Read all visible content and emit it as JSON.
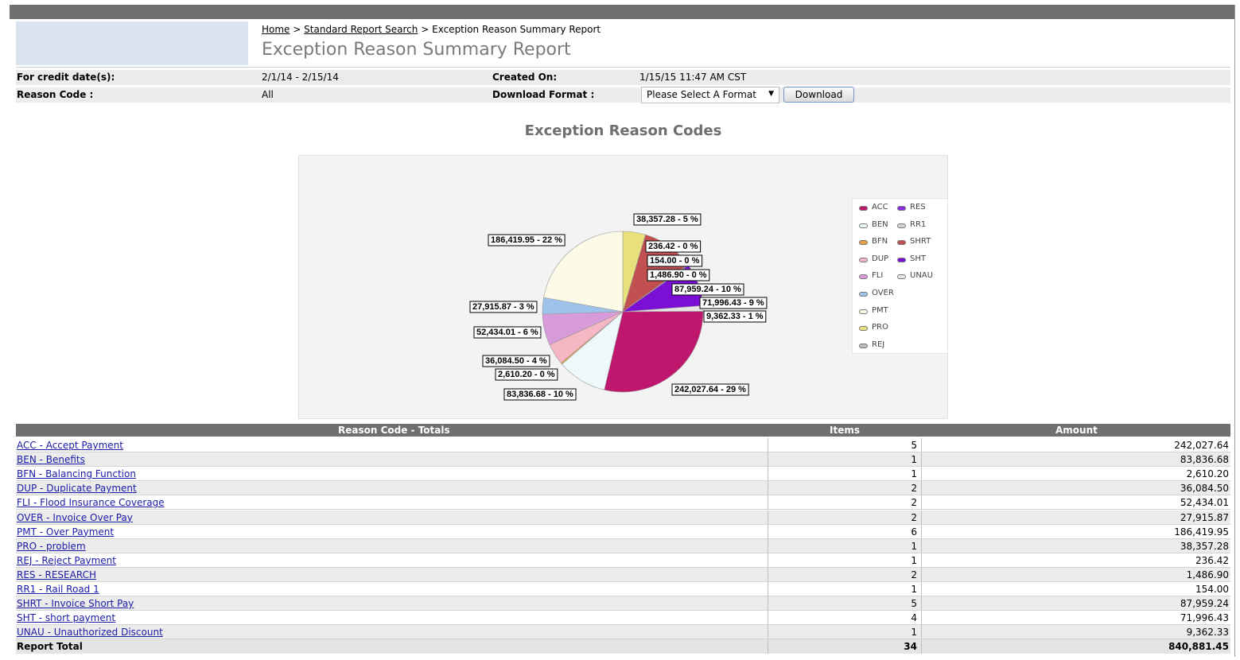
{
  "breadcrumb": {
    "home": "Home",
    "sep1": ">",
    "search": "Standard Report Search",
    "sep2": ">",
    "current": "Exception Reason Summary Report"
  },
  "page_title": "Exception Reason Summary Report",
  "info": {
    "credit_label": "For credit date(s):",
    "credit_value": "2/1/14 - 2/15/14",
    "created_label": "Created On:",
    "created_value": "1/15/15 11:47 AM CST",
    "reason_label": "Reason Code :",
    "reason_value": "All",
    "format_label": "Download Format :",
    "format_value": "Please Select A Format",
    "download_label": "Download"
  },
  "colors": {
    "ACC": "#c0176e",
    "BEN": "#eef8fb",
    "BFN": "#e8a040",
    "DUP": "#f6b7c4",
    "FLI": "#d79bd9",
    "OVER": "#9ec3ea",
    "PMT": "#fcfbe8",
    "PRO": "#e8e07a",
    "REJ": "#bdbdbd",
    "RES": "#8a2be2",
    "RR1": "#d4d4d4",
    "SHRT": "#c25050",
    "SHT": "#7b0fd6",
    "UNAU": "#e6e6e6"
  },
  "chart_data": {
    "type": "pie",
    "title": "Exception Reason Codes",
    "legend_position": "right",
    "slices": [
      {
        "code": "ACC",
        "value": 242027.64,
        "label": "242,027.64 - 29 %"
      },
      {
        "code": "BEN",
        "value": 83836.68,
        "label": "83,836.68 - 10 %"
      },
      {
        "code": "BFN",
        "value": 2610.2,
        "label": "2,610.20 - 0 %"
      },
      {
        "code": "DUP",
        "value": 36084.5,
        "label": "36,084.50 - 4 %"
      },
      {
        "code": "FLI",
        "value": 52434.01,
        "label": "52,434.01 - 6 %"
      },
      {
        "code": "OVER",
        "value": 27915.87,
        "label": "27,915.87 - 3 %"
      },
      {
        "code": "PMT",
        "value": 186419.95,
        "label": "186,419.95 - 22 %"
      },
      {
        "code": "PRO",
        "value": 38357.28,
        "label": "38,357.28 - 5 %"
      },
      {
        "code": "REJ",
        "value": 236.42,
        "label": "236.42 - 0 %"
      },
      {
        "code": "RES",
        "value": 1486.9,
        "label": "1,486.90 - 0 %"
      },
      {
        "code": "RR1",
        "value": 154.0,
        "label": "154.00 - 0 %"
      },
      {
        "code": "SHRT",
        "value": 87959.24,
        "label": "87,959.24 - 10 %"
      },
      {
        "code": "SHT",
        "value": 71996.43,
        "label": "71,996.43 - 9 %"
      },
      {
        "code": "UNAU",
        "value": 9362.33,
        "label": "9,362.33 - 1 %"
      }
    ],
    "legend": [
      "ACC",
      "BEN",
      "BFN",
      "DUP",
      "FLI",
      "OVER",
      "PMT",
      "PRO",
      "REJ",
      "RES",
      "RR1",
      "SHRT",
      "SHT",
      "UNAU"
    ]
  },
  "table": {
    "headers": [
      "Reason Code - Totals",
      "Items",
      "Amount"
    ],
    "rows": [
      {
        "label": "ACC - Accept Payment",
        "items": "5",
        "amount": "242,027.64"
      },
      {
        "label": "BEN - Benefits",
        "items": "1",
        "amount": "83,836.68"
      },
      {
        "label": "BFN - Balancing Function",
        "items": "1",
        "amount": "2,610.20"
      },
      {
        "label": "DUP - Duplicate Payment",
        "items": "2",
        "amount": "36,084.50"
      },
      {
        "label": "FLI - Flood Insurance Coverage",
        "items": "2",
        "amount": "52,434.01"
      },
      {
        "label": "OVER - Invoice Over Pay",
        "items": "2",
        "amount": "27,915.87"
      },
      {
        "label": "PMT - Over Payment",
        "items": "6",
        "amount": "186,419.95"
      },
      {
        "label": "PRO - problem",
        "items": "1",
        "amount": "38,357.28"
      },
      {
        "label": "REJ - Reject Payment",
        "items": "1",
        "amount": "236.42"
      },
      {
        "label": "RES - RESEARCH",
        "items": "2",
        "amount": "1,486.90"
      },
      {
        "label": "RR1 - Rail Road 1",
        "items": "1",
        "amount": "154.00"
      },
      {
        "label": "SHRT - Invoice Short Pay",
        "items": "5",
        "amount": "87,959.24"
      },
      {
        "label": "SHT - short payment",
        "items": "4",
        "amount": "71,996.43"
      },
      {
        "label": "UNAU - Unauthorized Discount",
        "items": "1",
        "amount": "9,362.33"
      }
    ],
    "total": {
      "label": "Report Total",
      "items": "34",
      "amount": "840,881.45"
    }
  }
}
